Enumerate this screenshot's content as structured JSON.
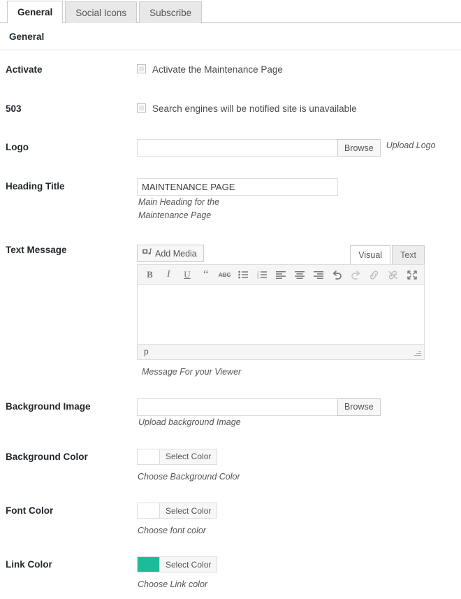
{
  "tabs": [
    {
      "label": "General",
      "active": true
    },
    {
      "label": "Social Icons",
      "active": false
    },
    {
      "label": "Subscribe",
      "active": false
    }
  ],
  "section": {
    "heading": "General"
  },
  "rows": {
    "activate": {
      "label": "Activate",
      "checkbox_label": "Activate the Maintenance Page",
      "checked": false
    },
    "error503": {
      "label": "503",
      "checkbox_label": "Search engines will be notified site is unavailable",
      "checked": false
    },
    "logo": {
      "label": "Logo",
      "value": "",
      "browse_label": "Browse",
      "hint": "Upload Logo"
    },
    "heading_title": {
      "label": "Heading Title",
      "value": "MAINTENANCE PAGE",
      "hint": "Main Heading for the Maintenance Page"
    },
    "text_message": {
      "label": "Text Message",
      "add_media_label": "Add Media",
      "mode_visual": "Visual",
      "mode_text": "Text",
      "active_mode": "Visual",
      "content": "",
      "status_path": "p",
      "hint": "Message For your Viewer"
    },
    "background_image": {
      "label": "Background Image",
      "value": "",
      "browse_label": "Browse",
      "hint": "Upload background Image"
    },
    "background_color": {
      "label": "Background Color",
      "button_label": "Select Color",
      "color": "#ffffff",
      "hint": "Choose Background Color"
    },
    "font_color": {
      "label": "Font Color",
      "button_label": "Select Color",
      "color": "#ffffff",
      "hint": "Choose font color"
    },
    "link_color": {
      "label": "Link Color",
      "button_label": "Select Color",
      "color": "#1cbc9b",
      "hint": "Choose Link color"
    }
  },
  "editor_toolbar": [
    {
      "name": "bold-icon",
      "glyph": "B",
      "disabled": false
    },
    {
      "name": "italic-icon",
      "glyph": "I",
      "disabled": false
    },
    {
      "name": "underline-icon",
      "glyph": "U",
      "disabled": false
    },
    {
      "name": "blockquote-icon",
      "glyph": "“",
      "disabled": false
    },
    {
      "name": "strikethrough-icon",
      "glyph": "ABC",
      "disabled": false
    },
    {
      "name": "bullet-list-icon",
      "glyph": "",
      "disabled": false
    },
    {
      "name": "numbered-list-icon",
      "glyph": "",
      "disabled": false
    },
    {
      "name": "align-left-icon",
      "glyph": "",
      "disabled": false
    },
    {
      "name": "align-center-icon",
      "glyph": "",
      "disabled": false
    },
    {
      "name": "align-right-icon",
      "glyph": "",
      "disabled": false
    },
    {
      "name": "undo-icon",
      "glyph": "",
      "disabled": false
    },
    {
      "name": "redo-icon",
      "glyph": "",
      "disabled": true
    },
    {
      "name": "link-icon",
      "glyph": "",
      "disabled": true
    },
    {
      "name": "unlink-icon",
      "glyph": "",
      "disabled": true
    },
    {
      "name": "fullscreen-icon",
      "glyph": "",
      "disabled": false
    }
  ]
}
